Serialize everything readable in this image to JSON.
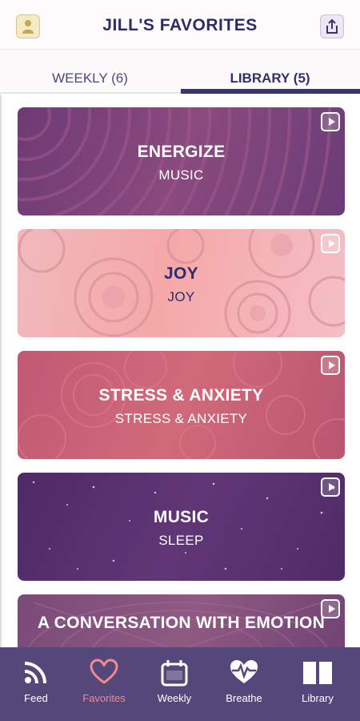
{
  "header": {
    "title": "JILL'S FAVORITES",
    "left_icon": "profile-icon",
    "right_icon": "share-icon"
  },
  "tabs": [
    {
      "label": "WEEKLY (6)",
      "active": false
    },
    {
      "label": "LIBRARY (5)",
      "active": true
    }
  ],
  "cards": [
    {
      "title": "ENERGIZE",
      "subtitle": "MUSIC",
      "theme": "#7a4279"
    },
    {
      "title": "JOY",
      "subtitle": "JOY",
      "theme": "#f2b1b6"
    },
    {
      "title": "STRESS & ANXIETY",
      "subtitle": "STRESS & ANXIETY",
      "theme": "#c65f77"
    },
    {
      "title": "MUSIC",
      "subtitle": "SLEEP",
      "theme": "#553070"
    },
    {
      "title": "A CONVERSATION WITH EMOTION",
      "subtitle": "",
      "theme": "#7d4c7a"
    }
  ],
  "nav": [
    {
      "label": "Feed",
      "icon": "feed-icon",
      "active": false
    },
    {
      "label": "Favorites",
      "icon": "heart-icon",
      "active": true
    },
    {
      "label": "Weekly",
      "icon": "calendar-icon",
      "active": false
    },
    {
      "label": "Breathe",
      "icon": "heartbeat-icon",
      "active": false
    },
    {
      "label": "Library",
      "icon": "book-icon",
      "active": false
    }
  ],
  "colors": {
    "brand_navy": "#2f2a6e",
    "nav_bg": "#56477a",
    "active_accent": "#f08a8f"
  }
}
